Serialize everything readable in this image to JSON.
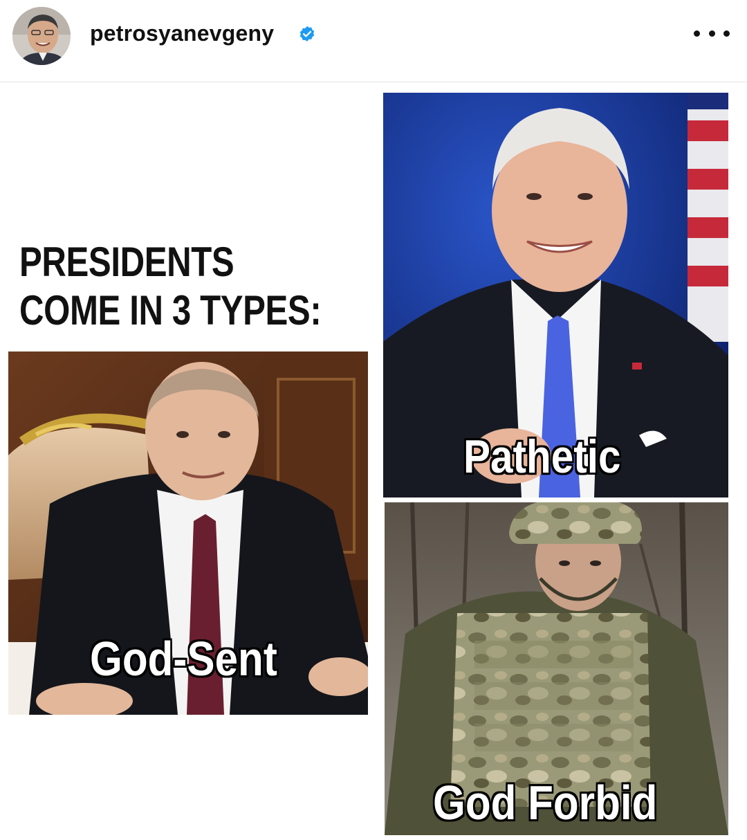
{
  "post": {
    "username": "petrosyanevgeny",
    "verified": true,
    "more_label": "•••"
  },
  "meme": {
    "heading_line1": "PRESIDENTS",
    "heading_line2": "COME IN 3 TYPES:",
    "captions": {
      "god_sent": "God-Sent",
      "pathetic": "Pathetic",
      "god_forbid": "God Forbid"
    }
  },
  "icons": {
    "verified": "verified-badge-icon",
    "more": "more-options-icon"
  },
  "colors": {
    "verified_blue": "#1d9bf0",
    "text": "#111111",
    "caption_fill": "#ffffff",
    "caption_outline": "#000000"
  }
}
